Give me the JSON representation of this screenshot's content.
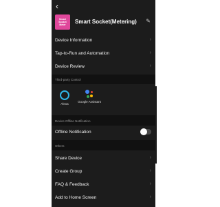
{
  "header": {
    "back_icon": "back-arrow-icon",
    "device_name": "Smart Socket(Metering)",
    "thumb_lines": [
      "Smart",
      "Socket",
      "Meter"
    ],
    "edit_icon": "pencil-icon"
  },
  "menu_top": [
    {
      "label": "Device Information"
    },
    {
      "label": "Tap-to-Run and Automation"
    },
    {
      "label": "Device Review"
    }
  ],
  "third_party": {
    "title": "Third-party Control",
    "items": [
      {
        "label": "Alexa"
      },
      {
        "label": "Google Assistant"
      }
    ]
  },
  "offline": {
    "title": "Device Offline Notification",
    "label": "Offline Notification",
    "enabled": false
  },
  "others": {
    "title": "Others",
    "items": [
      {
        "label": "Share Device"
      },
      {
        "label": "Create Group"
      },
      {
        "label": "FAQ & Feedback"
      },
      {
        "label": "Add to Home Screen"
      }
    ]
  },
  "colors": {
    "alexa": "#2fb5e7",
    "google": [
      "#4285f4",
      "#ea4335",
      "#fbbc05",
      "#34a853"
    ],
    "thumb": "#e0479b"
  }
}
